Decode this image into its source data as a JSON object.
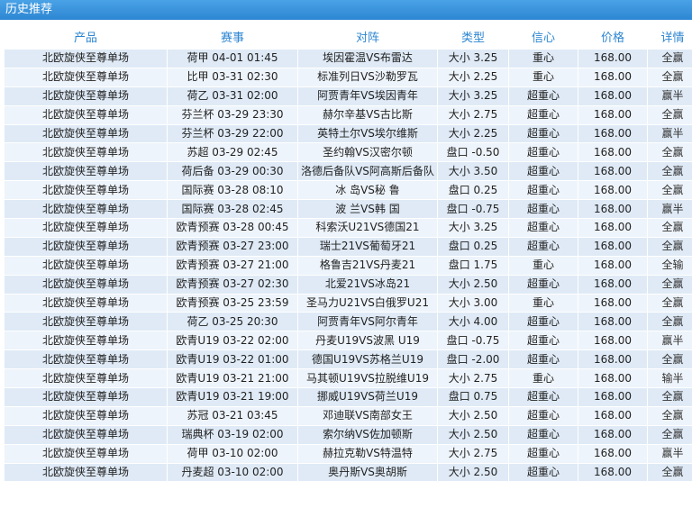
{
  "title": "历史推荐",
  "headers": [
    "产品",
    "赛事",
    "对阵",
    "类型",
    "信心",
    "价格",
    "详情"
  ],
  "rows": [
    [
      "北欧旋侠至尊单场",
      "荷甲 04-01 01:45",
      "埃因霍温VS布雷达",
      "大小 3.25",
      "重心",
      "168.00",
      "全赢"
    ],
    [
      "北欧旋侠至尊单场",
      "比甲 03-31 02:30",
      "标准列日VS沙勒罗瓦",
      "大小 2.25",
      "重心",
      "168.00",
      "全赢"
    ],
    [
      "北欧旋侠至尊单场",
      "荷乙 03-31 02:00",
      "阿贾青年VS埃因青年",
      "大小 3.25",
      "超重心",
      "168.00",
      "赢半"
    ],
    [
      "北欧旋侠至尊单场",
      "芬兰杯 03-29 23:30",
      "赫尔辛基VS古比斯",
      "大小 2.75",
      "超重心",
      "168.00",
      "全赢"
    ],
    [
      "北欧旋侠至尊单场",
      "芬兰杯 03-29 22:00",
      "英特土尔VS埃尔维斯",
      "大小 2.25",
      "超重心",
      "168.00",
      "赢半"
    ],
    [
      "北欧旋侠至尊单场",
      "苏超 03-29 02:45",
      "圣约翰VS汉密尔顿",
      "盘口 -0.50",
      "超重心",
      "168.00",
      "全赢"
    ],
    [
      "北欧旋侠至尊单场",
      "荷后备 03-29 00:30",
      "洛德后备队VS阿高斯后备队",
      "大小 3.50",
      "超重心",
      "168.00",
      "全赢"
    ],
    [
      "北欧旋侠至尊单场",
      "国际赛 03-28 08:10",
      "冰 岛VS秘 鲁",
      "盘口 0.25",
      "超重心",
      "168.00",
      "全赢"
    ],
    [
      "北欧旋侠至尊单场",
      "国际赛 03-28 02:45",
      "波 兰VS韩 国",
      "盘口 -0.75",
      "超重心",
      "168.00",
      "赢半"
    ],
    [
      "北欧旋侠至尊单场",
      "欧青预赛 03-28 00:45",
      "科索沃U21VS德国21",
      "大小 3.25",
      "超重心",
      "168.00",
      "全赢"
    ],
    [
      "北欧旋侠至尊单场",
      "欧青预赛 03-27 23:00",
      "瑞士21VS葡萄牙21",
      "盘口 0.25",
      "超重心",
      "168.00",
      "全赢"
    ],
    [
      "北欧旋侠至尊单场",
      "欧青预赛 03-27 21:00",
      "格鲁吉21VS丹麦21",
      "盘口 1.75",
      "重心",
      "168.00",
      "全输"
    ],
    [
      "北欧旋侠至尊单场",
      "欧青预赛 03-27 02:30",
      "北爱21VS冰岛21",
      "大小 2.50",
      "超重心",
      "168.00",
      "全赢"
    ],
    [
      "北欧旋侠至尊单场",
      "欧青预赛 03-25 23:59",
      "圣马力U21VS白俄罗U21",
      "大小 3.00",
      "重心",
      "168.00",
      "全赢"
    ],
    [
      "北欧旋侠至尊单场",
      "荷乙 03-25 20:30",
      "阿贾青年VS阿尔青年",
      "大小 4.00",
      "超重心",
      "168.00",
      "全赢"
    ],
    [
      "北欧旋侠至尊单场",
      "欧青U19 03-22 02:00",
      "丹麦U19VS波黑 U19",
      "盘口 -0.75",
      "超重心",
      "168.00",
      "赢半"
    ],
    [
      "北欧旋侠至尊单场",
      "欧青U19 03-22 01:00",
      "德国U19VS苏格兰U19",
      "盘口 -2.00",
      "超重心",
      "168.00",
      "全赢"
    ],
    [
      "北欧旋侠至尊单场",
      "欧青U19 03-21 21:00",
      "马其顿U19VS拉脱维U19",
      "大小 2.75",
      "重心",
      "168.00",
      "输半"
    ],
    [
      "北欧旋侠至尊单场",
      "欧青U19 03-21 19:00",
      "挪威U19VS荷兰U19",
      "盘口 0.75",
      "超重心",
      "168.00",
      "全赢"
    ],
    [
      "北欧旋侠至尊单场",
      "苏冠 03-21 03:45",
      "邓迪联VS南部女王",
      "大小 2.50",
      "超重心",
      "168.00",
      "全赢"
    ],
    [
      "北欧旋侠至尊单场",
      "瑞典杯 03-19 02:00",
      "索尔纳VS佐加顿斯",
      "大小 2.50",
      "超重心",
      "168.00",
      "全赢"
    ],
    [
      "北欧旋侠至尊单场",
      "荷甲 03-10 02:00",
      "赫拉克勒VS特温特",
      "大小 2.75",
      "超重心",
      "168.00",
      "赢半"
    ],
    [
      "北欧旋侠至尊单场",
      "丹麦超 03-10 02:00",
      "奥丹斯VS奥胡斯",
      "大小 2.50",
      "超重心",
      "168.00",
      "全赢"
    ]
  ]
}
